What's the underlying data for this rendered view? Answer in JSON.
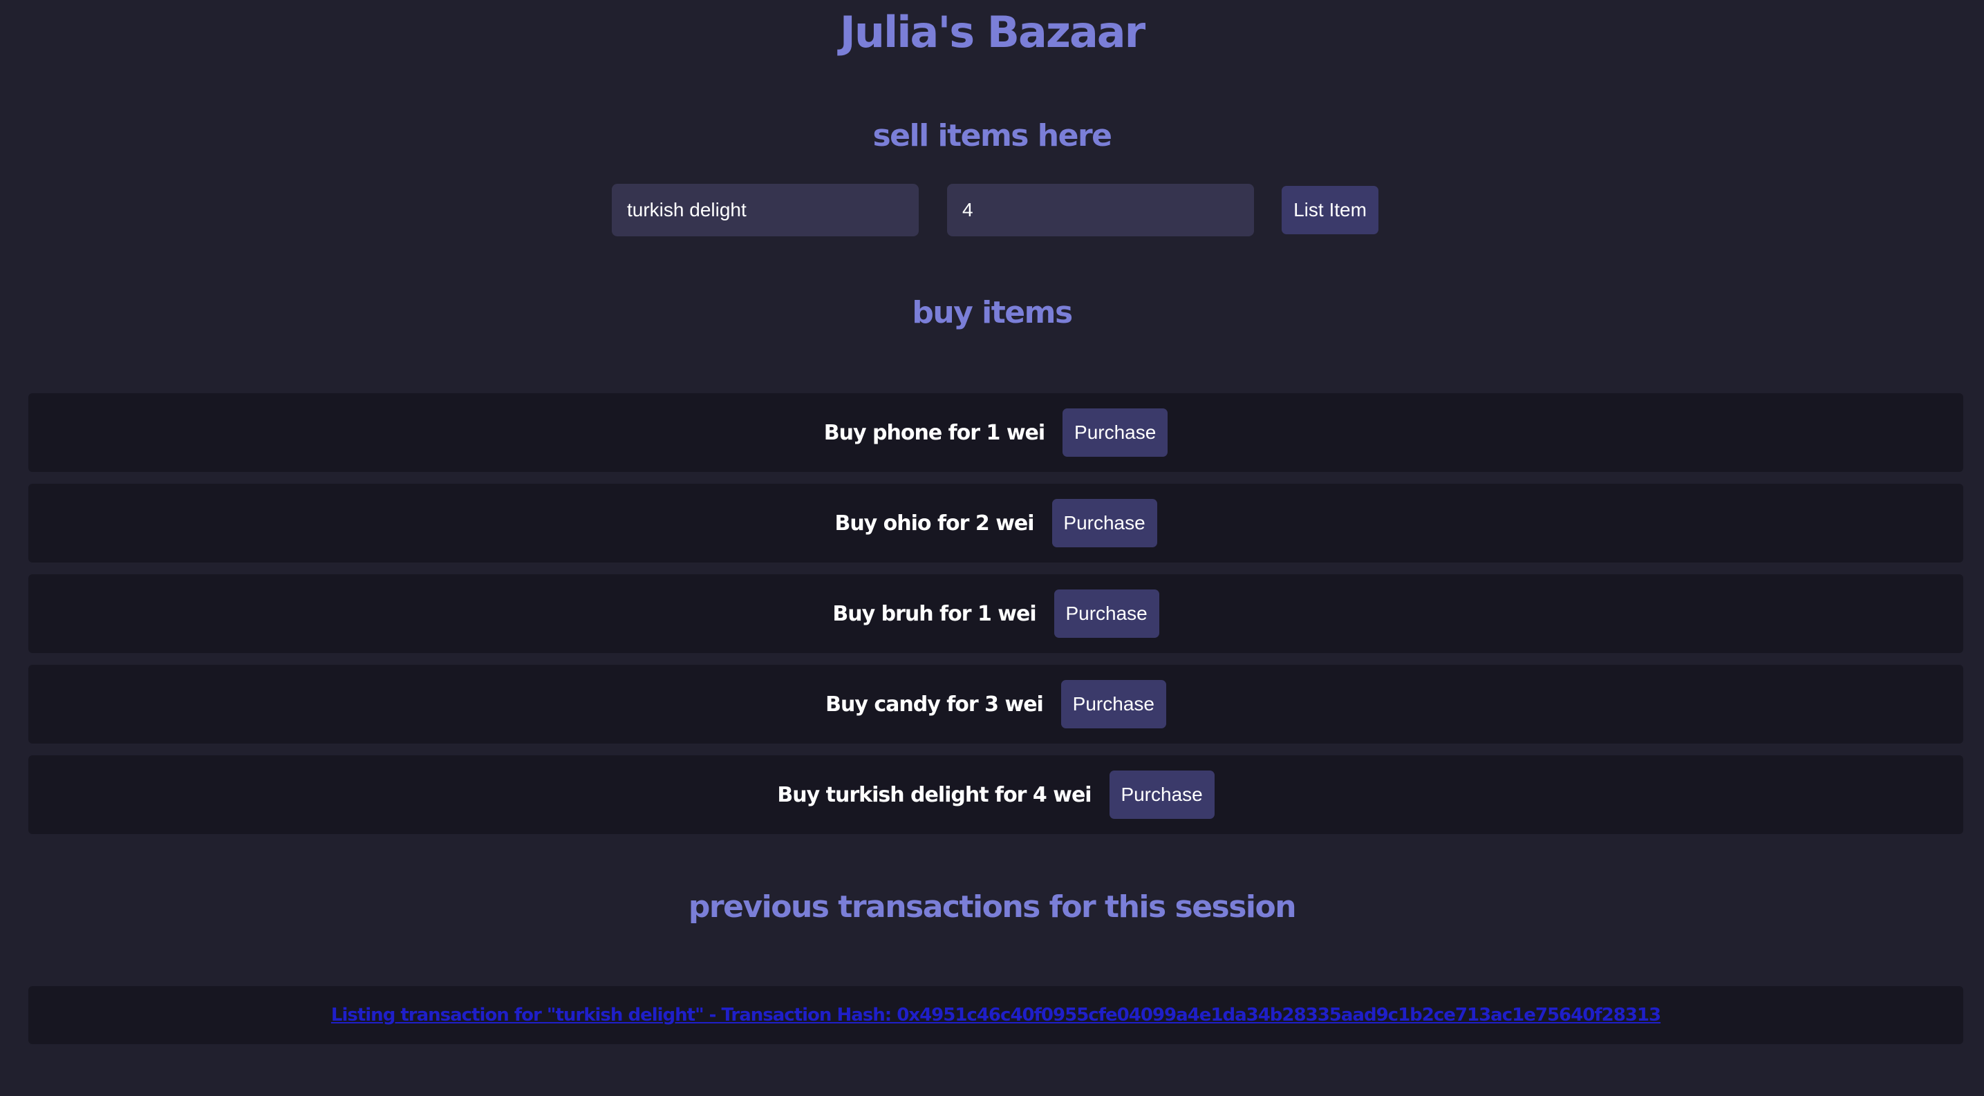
{
  "app": {
    "title": "Julia's Bazaar"
  },
  "sell": {
    "heading": "sell items here",
    "name_value": "turkish delight",
    "price_value": "4",
    "list_button": "List Item"
  },
  "buy": {
    "heading": "buy items",
    "items": [
      {
        "label": "Buy phone for 1 wei",
        "button": "Purchase"
      },
      {
        "label": "Buy ohio for 2 wei",
        "button": "Purchase"
      },
      {
        "label": "Buy bruh for 1 wei",
        "button": "Purchase"
      },
      {
        "label": "Buy candy for 3 wei",
        "button": "Purchase"
      },
      {
        "label": "Buy turkish delight for 4 wei",
        "button": "Purchase"
      }
    ]
  },
  "transactions": {
    "heading": "previous transactions for this session",
    "items": [
      {
        "text": "Listing transaction for \"turkish delight\" - Transaction Hash: 0x4951c46c40f0955cfe04099a4e1da34b28335aad9c1b2ce713ac1e75640f28313"
      }
    ]
  },
  "colors": {
    "background": "#21202e",
    "heading": "#7b7fd8",
    "row_background": "#171621",
    "button": "#3b3a6a",
    "input": "#36344f",
    "link": "#1f1fc9"
  }
}
